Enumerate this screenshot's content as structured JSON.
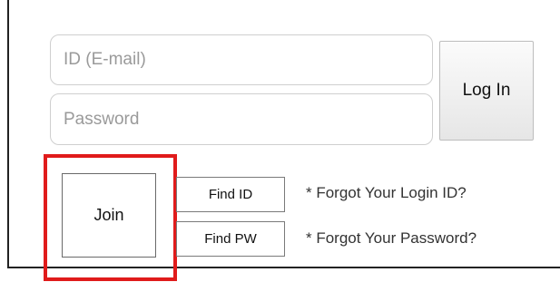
{
  "login": {
    "id_placeholder": "ID (E-mail)",
    "password_placeholder": "Password",
    "login_label": "Log In"
  },
  "actions": {
    "join_label": "Join",
    "find_id_label": "Find ID",
    "find_pw_label": "Find PW"
  },
  "hints": {
    "forgot_id": "* Forgot Your Login ID?",
    "forgot_password": "* Forgot Your Password?"
  },
  "colors": {
    "highlight": "#e01b1b"
  }
}
